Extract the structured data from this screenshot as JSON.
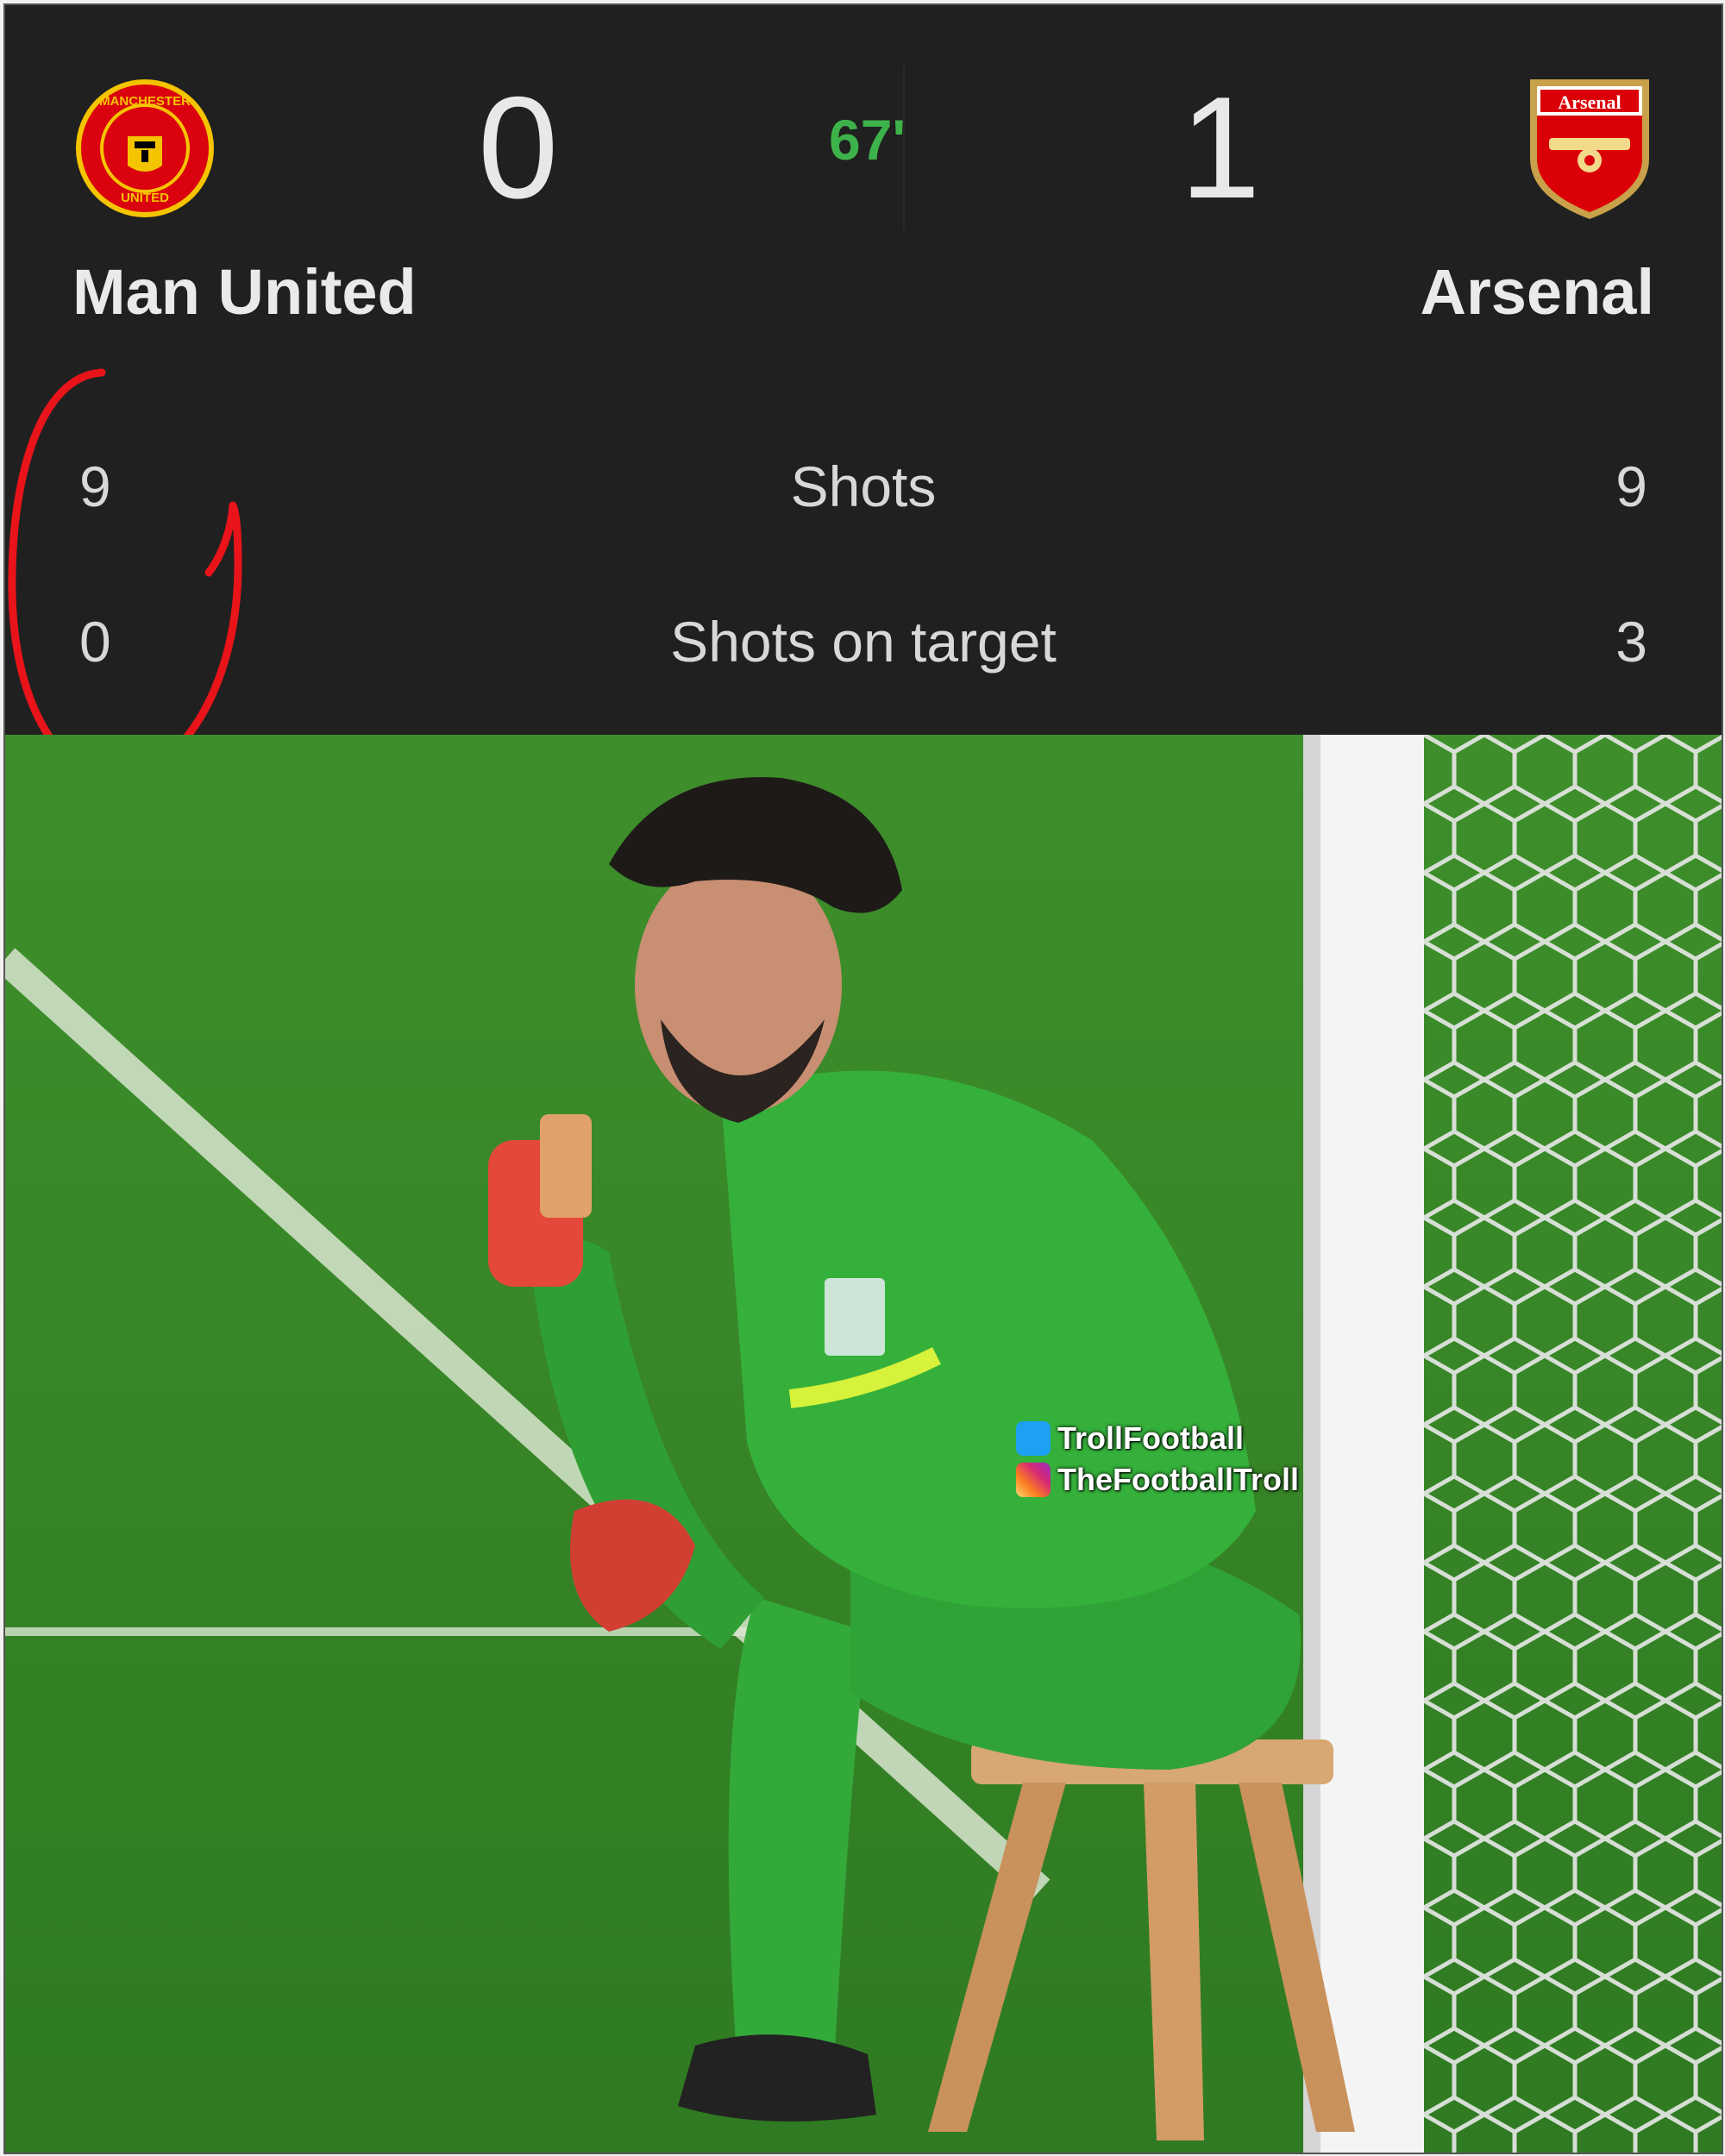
{
  "match": {
    "home": {
      "name": "Man United",
      "score": "0",
      "crest_text_top": "MANCHESTER",
      "crest_text_bottom": "UNITED"
    },
    "away": {
      "name": "Arsenal",
      "score": "1",
      "crest_text": "Arsenal"
    },
    "clock": "67'"
  },
  "stats": [
    {
      "label": "Shots",
      "home": "9",
      "away": "9"
    },
    {
      "label": "Shots on target",
      "home": "0",
      "away": "3"
    }
  ],
  "annotation": {
    "color": "#e8141a"
  },
  "watermark": {
    "twitter": "TrollFootball",
    "instagram": "TheFootballTroll"
  },
  "colors": {
    "panel_bg": "#202020",
    "clock": "#3db24a",
    "pitch": "#3d8a2a",
    "kit": "#35b03a"
  },
  "icons": [
    "man-united-crest",
    "arsenal-crest",
    "twitter-icon",
    "instagram-icon"
  ]
}
